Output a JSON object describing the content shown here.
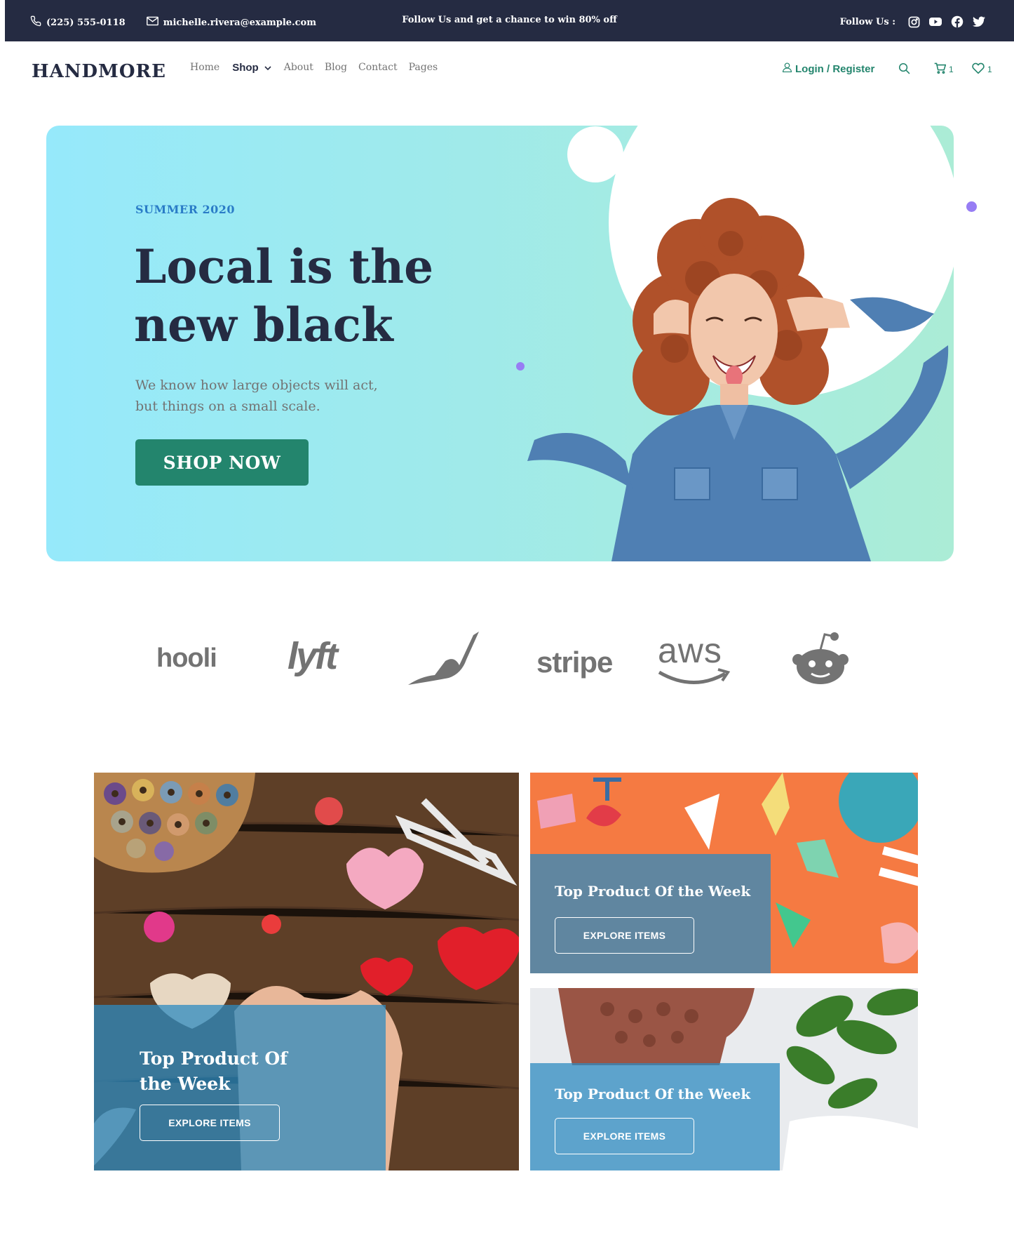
{
  "topbar": {
    "phone": "(225) 555-0118",
    "email": "michelle.rivera@example.com",
    "promo": "Follow Us  and get a chance to win 80% off",
    "follow_label": "Follow Us  :",
    "socials": [
      "instagram-icon",
      "youtube-icon",
      "facebook-icon",
      "twitter-icon"
    ]
  },
  "nav": {
    "logo": "HANDMORE",
    "menu": [
      "Home",
      "Shop",
      "About",
      "Blog",
      "Contact",
      "Pages"
    ],
    "login": "Login / Register",
    "cart_count": "1",
    "wishlist_count": "1"
  },
  "hero": {
    "season": "SUMMER 2020",
    "title_line1": "Local is the",
    "title_line2": "new black",
    "subtitle_line1": "We know how large objects will act,",
    "subtitle_line2": "but things on a small scale.",
    "cta": "SHOP NOW"
  },
  "brands": [
    "hooli",
    "lyft",
    "robinhood",
    "stripe",
    "aws",
    "reddit"
  ],
  "brand_text": {
    "hooli": "hooli",
    "lyft": "lyft",
    "stripe": "stripe",
    "aws": "aws"
  },
  "cards": [
    {
      "title_line1": "Top Product Of",
      "title_line2": "the Week",
      "button": "EXPLORE ITEMS"
    },
    {
      "title": "Top Product Of the Week",
      "button": "EXPLORE ITEMS"
    },
    {
      "title": "Top Product Of the Week",
      "button": "EXPLORE ITEMS"
    }
  ],
  "colors": {
    "dark": "#252b42",
    "accent_green": "#23856d",
    "accent_blue": "#2a7cc7",
    "hero_start": "#96e9fb",
    "hero_end": "#abecd6",
    "muted": "#737373",
    "dot_purple": "#977df4"
  }
}
